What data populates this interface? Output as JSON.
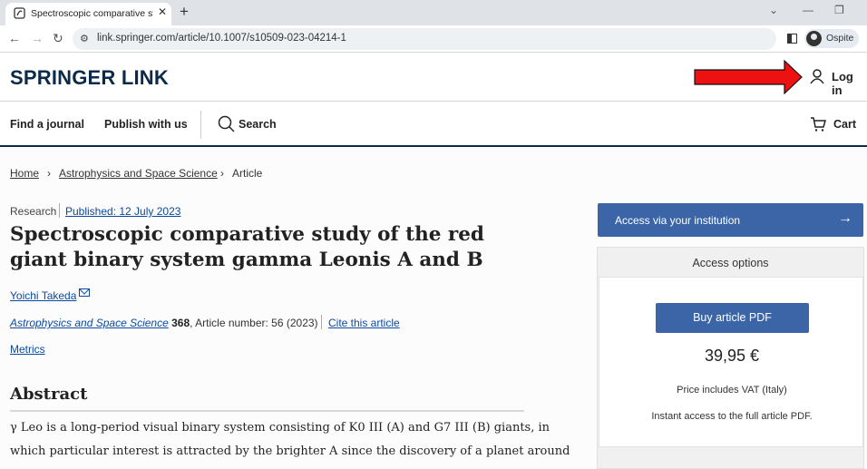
{
  "browser": {
    "tab_title": "Spectroscopic comparative study",
    "url": "link.springer.com/article/10.1007/s10509-023-04214-1",
    "profile_label": "Ospite"
  },
  "header": {
    "logo": "SPRINGER LINK",
    "login": "Log in"
  },
  "nav": {
    "find_journal": "Find a journal",
    "publish": "Publish with us",
    "search": "Search",
    "cart": "Cart"
  },
  "breadcrumb": {
    "home": "Home",
    "sep1": "›",
    "section": "Astrophysics and Space Science",
    "sep2": "›",
    "current": "Article"
  },
  "article": {
    "type": "Research",
    "published": "Published: 12 July 2023",
    "title": "Spectroscopic comparative study of the red giant binary system gamma Leonis A and B",
    "author": "Yoichi Takeda",
    "journal": "Astrophysics and Space Science",
    "volume": "368",
    "article_number": ", Article number: 56 (2023)",
    "cite": "Cite this article",
    "metrics": "Metrics",
    "abstract_heading": "Abstract",
    "abstract_line1": "γ Leo is a long-period visual binary system consisting of K0 III (A) and G7 III (B) giants, in",
    "abstract_line2": "which particular interest is attracted by the brighter A since the discovery of a planet around"
  },
  "access": {
    "institution": "Access via your institution",
    "options_heading": "Access options",
    "buy_label": "Buy article PDF",
    "price": "39,95 €",
    "vat_note": "Price includes VAT (Italy)",
    "instant_note": "Instant access to the full article PDF."
  }
}
